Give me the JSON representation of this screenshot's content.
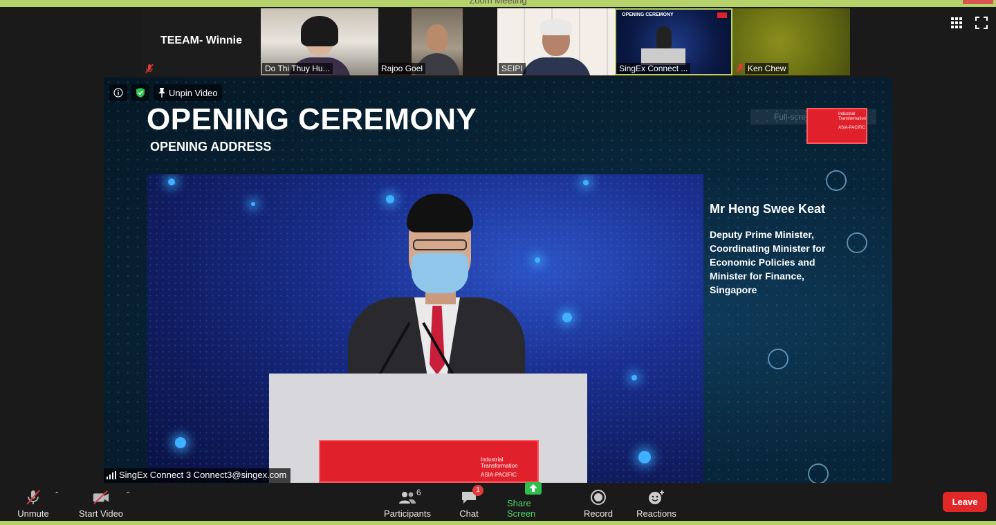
{
  "window": {
    "title": "Zoom Meeting"
  },
  "participants_strip": [
    {
      "name": "TEEAM- Winnie",
      "muted": true,
      "video": false
    },
    {
      "name": "Do Thi Thuy Hu...",
      "muted": false,
      "video": true
    },
    {
      "name": "Rajoo Goel",
      "muted": false,
      "video": true
    },
    {
      "name": "SEIPI",
      "muted": false,
      "video": true
    },
    {
      "name": "SingEx Connect ...",
      "muted": false,
      "video": true,
      "active": true
    },
    {
      "name": "Ken Chew",
      "muted": true,
      "video": true
    }
  ],
  "mini_slide_title": "OPENING CEREMONY",
  "stage": {
    "unpin_label": "Unpin Video",
    "slide_title": "OPENING CEREMONY",
    "slide_subtitle": "OPENING ADDRESS",
    "snip_text": "Full-screen Snip",
    "logo_text_1": "Industrial",
    "logo_text_2": "Transformation",
    "logo_text_3": "ASIA-PACIFIC",
    "speaker_name": "Mr Heng Swee Keat",
    "speaker_role_lines": [
      "Deputy Prime Minister,",
      "Coordinating Minister for",
      "Economic Policies and",
      "Minister for Finance,",
      "Singapore"
    ],
    "sharer_label": "SingEx Connect 3 Connect3@singex.com"
  },
  "toolbar": {
    "unmute_label": "Unmute",
    "start_video_label": "Start Video",
    "participants_label": "Participants",
    "participants_count": "6",
    "chat_label": "Chat",
    "chat_badge": "1",
    "share_label": "Share Screen",
    "record_label": "Record",
    "reactions_label": "Reactions",
    "leave_label": "Leave"
  },
  "colors": {
    "accent_green": "#4fd866",
    "leave_red": "#e02828",
    "frame_green": "#b5d36a",
    "event_red": "#e0202a"
  }
}
